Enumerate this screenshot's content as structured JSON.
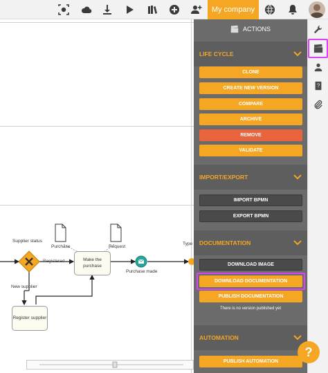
{
  "topbar": {
    "icons": [
      "eye-icon",
      "cloud-icon",
      "download-icon",
      "play-icon",
      "books-icon",
      "add-icon",
      "add-user-icon"
    ],
    "company_label": "My company",
    "right_icons": [
      "globe-icon",
      "bell-icon",
      "avatar"
    ]
  },
  "panel": {
    "title": "ACTIONS",
    "sections": {
      "lifecycle": {
        "title": "LIFE CYCLE",
        "buttons": [
          "CLONE",
          "CREATE NEW VERSION",
          "COMPARE",
          "ARCHIVE",
          "REMOVE",
          "VALIDATE"
        ]
      },
      "import_export": {
        "title": "IMPORT/EXPORT",
        "buttons": [
          "IMPORT BPMN",
          "EXPORT BPMN"
        ]
      },
      "documentation": {
        "title": "DOCUMENTATION",
        "buttons": [
          "DOWNLOAD IMAGE",
          "DOWNLOAD DOCUMENTATION",
          "PUBLISH DOCUMENTATION"
        ],
        "note": "There is no version published yet"
      },
      "automation": {
        "title": "AUTOMATION",
        "buttons": [
          "PUBLISH AUTOMATION"
        ]
      }
    }
  },
  "diagram": {
    "labels": {
      "supplier_status": "Supplier status",
      "purchase": "Purchase",
      "request": "Request",
      "registered": "Registered",
      "new_supplier": "New supplier",
      "purchase_made": "Purchase made",
      "type": "Type"
    },
    "tasks": {
      "make_purchase": "Make the purchase",
      "register_supplier": "Register supplier"
    }
  },
  "strip": {
    "icons": [
      "wrench-icon",
      "clapperboard-icon",
      "users-icon",
      "help-book-icon",
      "paperclip-icon"
    ]
  },
  "help_label": "?",
  "colors": {
    "accent": "#f5a623",
    "danger": "#e8643c",
    "panel": "#6b6b6b",
    "highlight": "#e040fb"
  }
}
